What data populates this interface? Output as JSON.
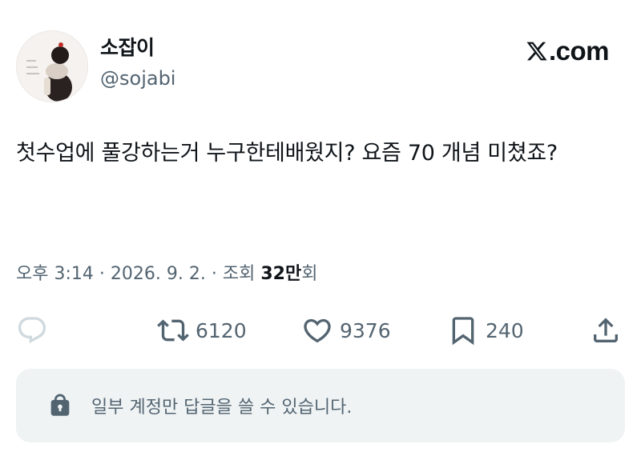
{
  "header": {
    "display_name": "소잡이",
    "handle": "@sojabi",
    "brand_suffix": ".com",
    "avatar_icon": "avatar-image"
  },
  "tweet": {
    "text": "첫수업에 풀강하는거 누구한테배웠지? 요즘 70 개념 미쳤죠?"
  },
  "meta": {
    "time": "오후 3:14",
    "date": "2026. 9. 2.",
    "views_label": "조회",
    "views_count": "32만",
    "views_suffix": "회",
    "separator": "·"
  },
  "actions": {
    "reply": {
      "icon": "reply-icon"
    },
    "retweet": {
      "icon": "retweet-icon",
      "count": "6120"
    },
    "like": {
      "icon": "heart-icon",
      "count": "9376"
    },
    "bookmark": {
      "icon": "bookmark-icon",
      "count": "240"
    },
    "share": {
      "icon": "share-icon"
    }
  },
  "reply_restriction": {
    "icon": "lock-icon",
    "text": "일부 계정만 답글을 쓸 수 있습니다."
  },
  "colors": {
    "text_primary": "#0f1419",
    "text_secondary": "#536471",
    "reply_box_bg": "#eff3f4"
  }
}
